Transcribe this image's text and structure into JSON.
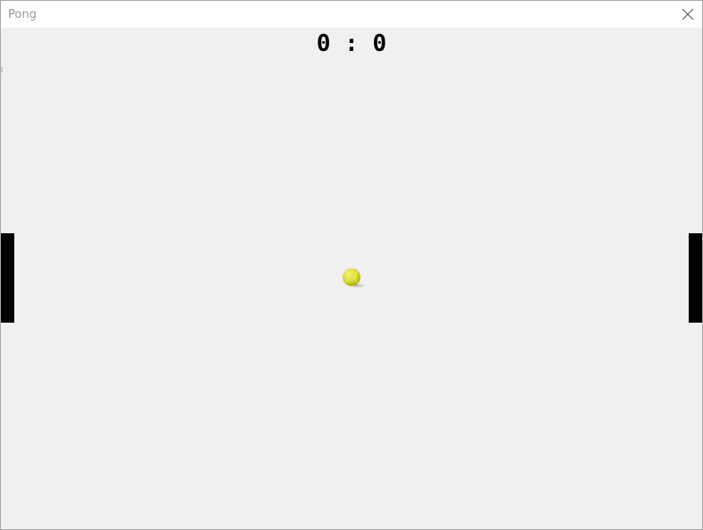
{
  "window": {
    "title": "Pong"
  },
  "game": {
    "score": {
      "left": "0",
      "separator": ":",
      "right": "0",
      "display": "0 : 0"
    },
    "paddle_color": "#000000",
    "background_color": "#f0f0f0",
    "ball_color": "#e4e83a",
    "ball_icon": "tennis-ball-icon"
  }
}
